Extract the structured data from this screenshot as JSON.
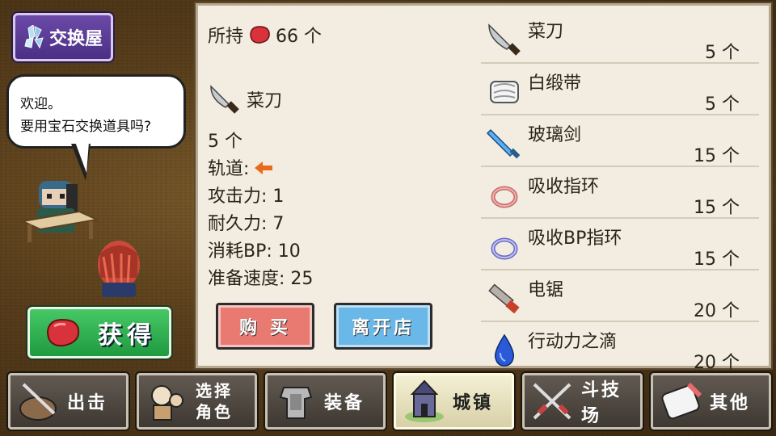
{
  "shop": {
    "title": "交换屋",
    "icon": "crystal-shop-icon"
  },
  "npc": {
    "greeting_line1": "欢迎。",
    "greeting_line2": "要用宝石交换道具吗?"
  },
  "get_button": {
    "label": "获得",
    "icon": "red-gem-icon"
  },
  "detail": {
    "owned_label": "所持",
    "owned_value": "66 个",
    "item_name": "菜刀",
    "item_icon": "kitchen-knife-icon",
    "quantity": "5 个",
    "track_label": "轨道:",
    "track_icon": "left-arrow-icon",
    "attack": "攻击力: 1",
    "durability": "耐久力: 7",
    "bp_cost": "消耗BP: 10",
    "prep_speed": "准备速度: 25"
  },
  "buttons": {
    "buy": "购 买",
    "leave": "离开店"
  },
  "items": [
    {
      "name": "菜刀",
      "price": "5 个",
      "icon": "kitchen-knife-icon"
    },
    {
      "name": "白缎带",
      "price": "5 个",
      "icon": "white-ribbon-icon"
    },
    {
      "name": "玻璃剑",
      "price": "15 个",
      "icon": "glass-sword-icon"
    },
    {
      "name": "吸收指环",
      "price": "15 个",
      "icon": "red-ring-icon"
    },
    {
      "name": "吸收BP指环",
      "price": "15 个",
      "icon": "blue-ring-icon"
    },
    {
      "name": "电锯",
      "price": "20 个",
      "icon": "chainsaw-icon"
    },
    {
      "name": "行动力之滴",
      "price": "20 个",
      "icon": "blue-drop-icon"
    }
  ],
  "nav": [
    {
      "label": "出击",
      "icon": "sortie-icon"
    },
    {
      "label_line1": "选择",
      "label_line2": "角色",
      "icon": "character-select-icon"
    },
    {
      "label": "装备",
      "icon": "armor-icon"
    },
    {
      "label": "城镇",
      "icon": "town-icon",
      "active": true
    },
    {
      "label": "斗技场",
      "icon": "arena-swords-icon"
    },
    {
      "label": "其他",
      "icon": "other-icon"
    }
  ],
  "colors": {
    "accent_gem": "#d8323a",
    "panel_bg": "#f2ede0",
    "buy_button": "#e87a72",
    "leave_button": "#6ab8e8",
    "get_button": "#2fb04f"
  }
}
